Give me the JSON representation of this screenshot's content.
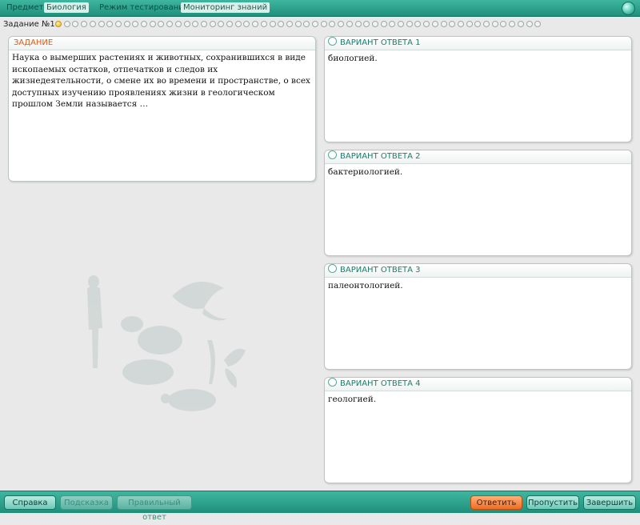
{
  "topbar": {
    "subject_label": "Предмет:",
    "subject_value": "Биология",
    "mode_label": "Режим тестирования:",
    "mode_value": "Мониторинг знаний"
  },
  "progress": {
    "label": "Задание №1:",
    "total": 57,
    "current": 1
  },
  "task": {
    "header": "ЗАДАНИЕ",
    "text": "Наука о вымерших растениях и животных, сохранившихся в виде ископаемых остатков, отпечатков и следов их жизнедеятельности, о смене их во времени и пространстве, о всех доступных изучению проявлениях жизни в геологическом прошлом Земли называется …"
  },
  "answers": [
    {
      "header": "ВАРИАНТ ОТВЕТА 1",
      "text": "биологией."
    },
    {
      "header": "ВАРИАНТ ОТВЕТА 2",
      "text": "бактериологией."
    },
    {
      "header": "ВАРИАНТ ОТВЕТА 3",
      "text": "палеонтологией."
    },
    {
      "header": "ВАРИАНТ ОТВЕТА 4",
      "text": "геологией."
    }
  ],
  "buttons": {
    "help": "Справка",
    "hint": "Подсказка",
    "correct_answer": "Правильный ответ",
    "answer": "Ответить",
    "skip": "Пропустить",
    "finish": "Завершить"
  },
  "colors": {
    "accent": "#2aa38e",
    "task_header": "#e05a14",
    "answer_button": "#f06d22"
  }
}
